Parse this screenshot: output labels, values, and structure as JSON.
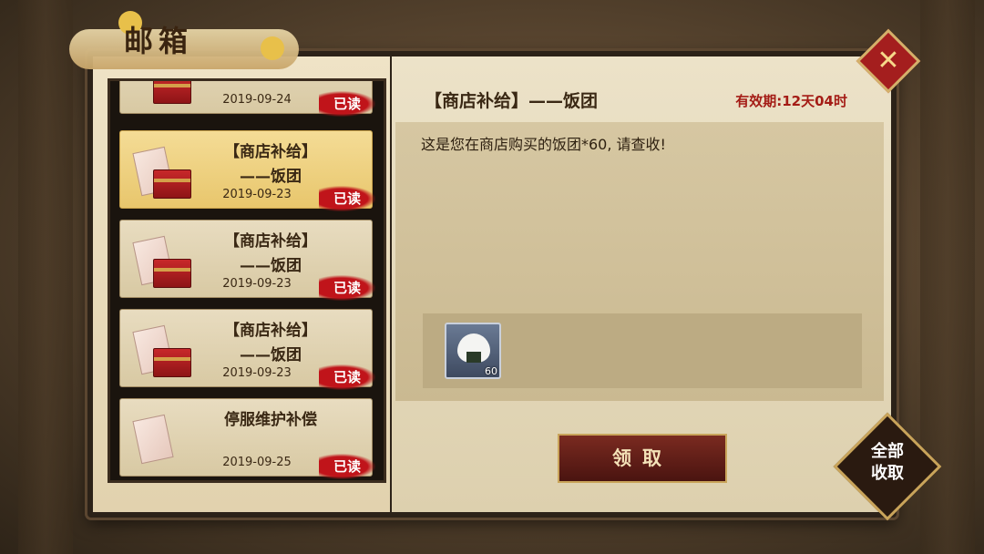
{
  "header": {
    "title": "邮箱"
  },
  "close_icon": "close-icon",
  "mails": [
    {
      "title": "",
      "date": "2019-09-24",
      "read_label": "已读",
      "selected": false
    },
    {
      "title": "【商店补给】\n——饭团",
      "date": "2019-09-23",
      "read_label": "已读",
      "selected": true
    },
    {
      "title": "【商店补给】\n——饭团",
      "date": "2019-09-23",
      "read_label": "已读",
      "selected": false
    },
    {
      "title": "【商店补给】\n——饭团",
      "date": "2019-09-23",
      "read_label": "已读",
      "selected": false
    },
    {
      "title": "停服维护补偿",
      "date": "2019-09-25",
      "read_label": "已读",
      "selected": false
    }
  ],
  "detail": {
    "title": "【商店补给】——饭团",
    "expiry": "有效期:12天04时",
    "content": "这是您在商店购买的饭团*60, 请查收!",
    "reward": {
      "icon": "rice-ball-icon",
      "count": "60"
    }
  },
  "buttons": {
    "claim": "领取",
    "claim_all": "全部\n收取"
  },
  "colors": {
    "accent_red": "#a41c16",
    "selected_mail": "#f4dc96"
  }
}
